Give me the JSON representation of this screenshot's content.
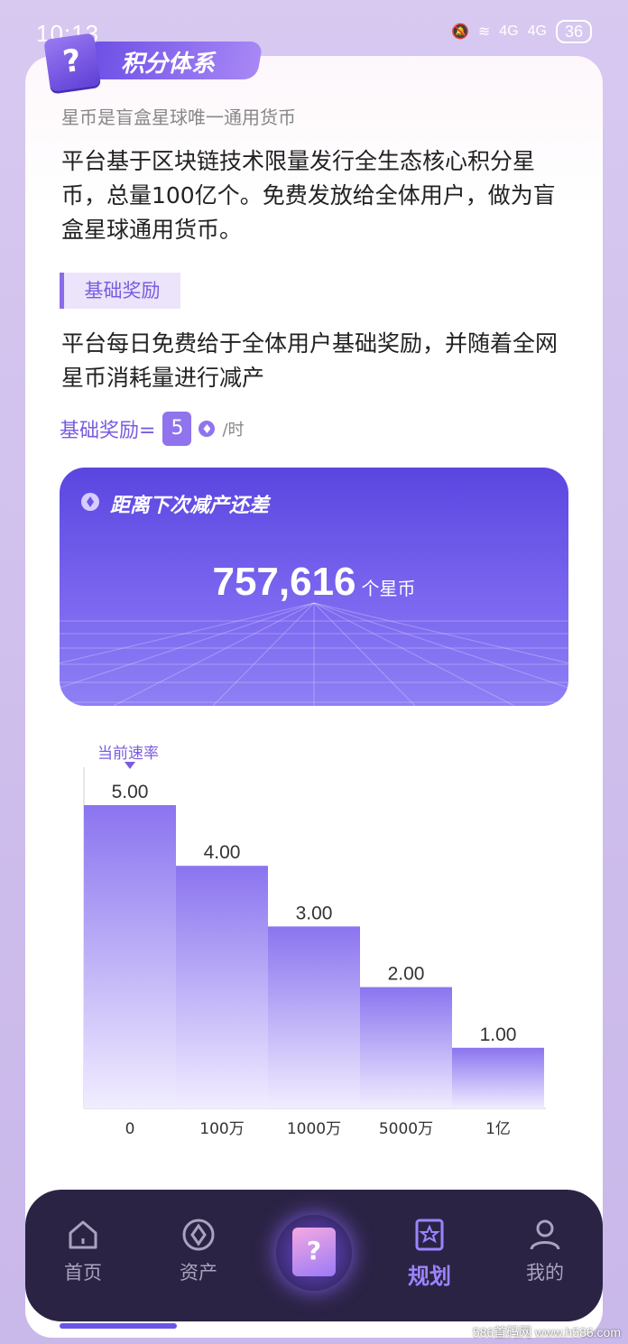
{
  "status_bar": {
    "time": "10:13",
    "icons": [
      "bell-off",
      "wifi",
      "4G",
      "4G"
    ],
    "signal_label_1": "4G",
    "signal_label_2": "4G",
    "battery": "36"
  },
  "header": {
    "badge_icon": "?",
    "title": "积分体系"
  },
  "section": {
    "subtitle": "星币是盲盒星球唯一通用货币",
    "intro": "平台基于区块链技术限量发行全生态核心积分星币，总量100亿个。免费发放给全体用户，做为盲盒星球通用货币。",
    "tag": "基础奖励",
    "description": "平台每日免费给于全体用户基础奖励，并随着全网星币消耗量进行减产",
    "rate_label": "基础奖励=",
    "rate_value": "5",
    "rate_unit": "/时"
  },
  "banner": {
    "title": "距离下次减产还差",
    "value": "757,616",
    "unit": "个星币"
  },
  "chart_data": {
    "type": "bar",
    "categories": [
      "0",
      "100万",
      "1000万",
      "5000万",
      "1亿"
    ],
    "values": [
      5.0,
      4.0,
      3.0,
      2.0,
      1.0
    ],
    "value_labels": [
      "5.00",
      "4.00",
      "3.00",
      "2.00",
      "1.00"
    ],
    "annotation": "当前速率",
    "annotated_index": 0,
    "ylim": [
      0,
      5
    ],
    "grid": false,
    "colors": {
      "bar_top": "#8b74ef",
      "bar_bottom": "#f1edff"
    }
  },
  "nav": {
    "items": [
      {
        "label": "首页",
        "icon": "home-icon"
      },
      {
        "label": "资产",
        "icon": "diamond-icon"
      },
      {
        "label": "规划",
        "icon": "star-book-icon",
        "active": true
      },
      {
        "label": "我的",
        "icon": "person-icon"
      }
    ],
    "center_icon": "?"
  },
  "watermark": "586首码网 www.h586.com",
  "colors": {
    "accent": "#7a5ce0",
    "banner_top": "#5a46e0",
    "nav_bg": "#2b2344"
  }
}
